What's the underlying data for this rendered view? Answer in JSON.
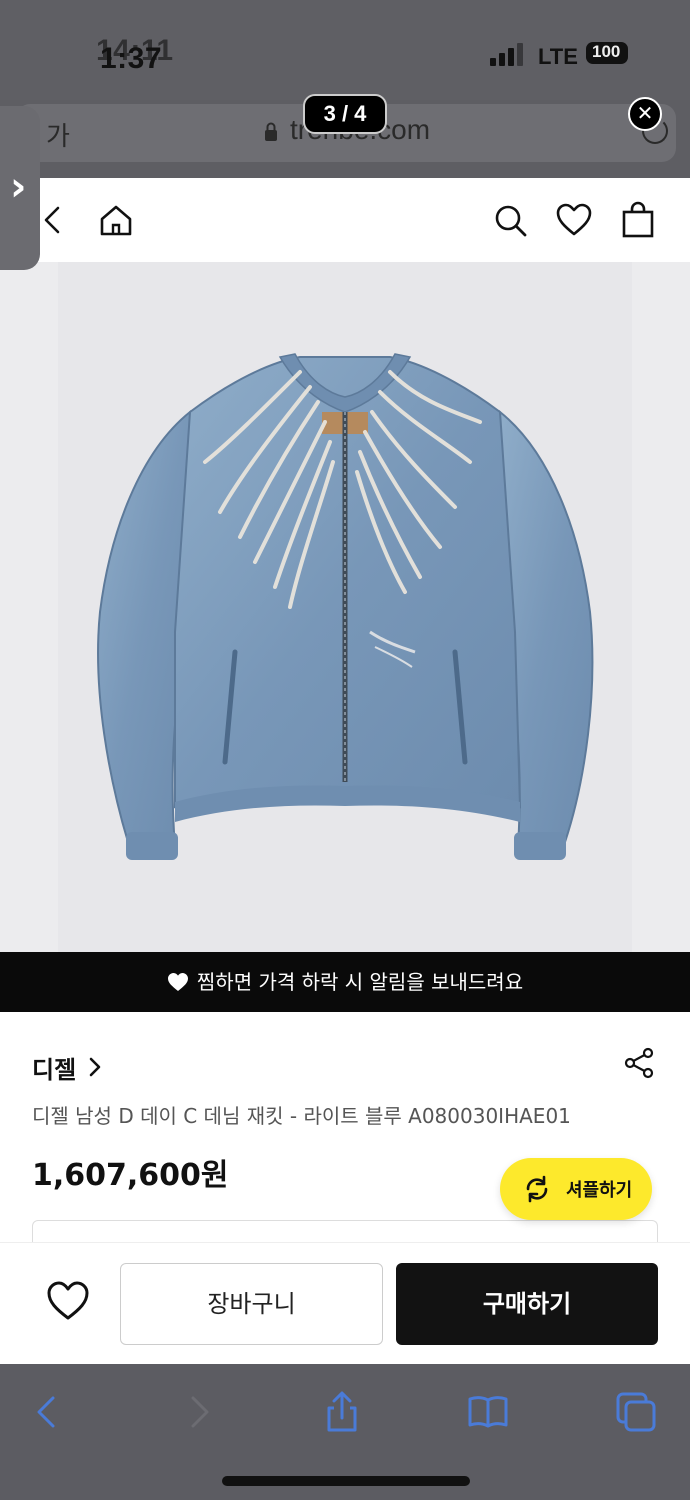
{
  "status_bar": {
    "time": "1:37",
    "time_ghost": "14:11",
    "network": "LTE",
    "battery": "100"
  },
  "browser": {
    "url": "trenbe.com",
    "prev_text": "가",
    "page_counter": "3 / 4",
    "close_icon": "close-icon"
  },
  "header": {
    "icons": [
      "back-icon",
      "home-icon",
      "search-icon",
      "heart-icon",
      "shopping-bag-icon"
    ]
  },
  "product_image": {
    "description_icon": "denim-jacket-image"
  },
  "wish_banner": {
    "text": "찜하면 가격 하락 시 알림을 보내드려요"
  },
  "product": {
    "brand": "디젤",
    "name": "디젤 남성 D 데이 C 데님 재킷 - 라이트 블루 A080030IHAE01",
    "price": "1,607,600원"
  },
  "shuffle": {
    "label": "셔플하기"
  },
  "actions": {
    "cart_label": "장바구니",
    "buy_label": "구매하기"
  },
  "colors": {
    "accent_yellow": "#fde92c",
    "buy_button": "#121212",
    "denim": "#7e9dbd"
  }
}
